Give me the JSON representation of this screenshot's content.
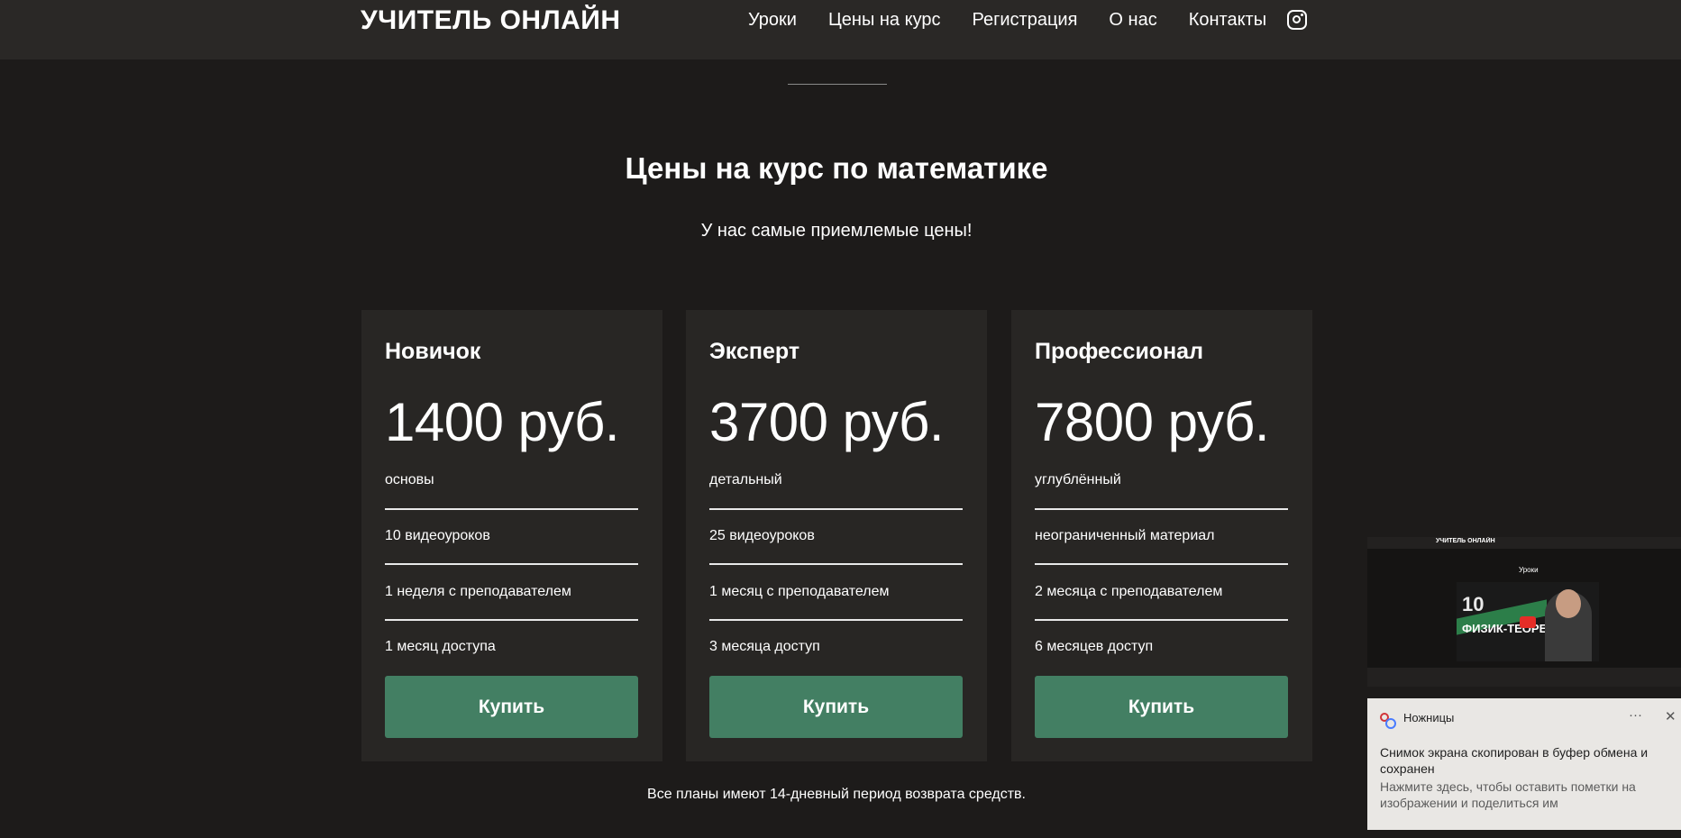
{
  "header": {
    "logo": "УЧИТЕЛЬ ОНЛАЙН",
    "nav": [
      "Уроки",
      "Цены на курс",
      "Регистрация",
      "О нас",
      "Контакты"
    ]
  },
  "section": {
    "title": "Цены на курс по математике",
    "subtitle": "У нас самые приемлемые цены!",
    "note": "Все планы имеют 14-дневный период возврата средств."
  },
  "plans": [
    {
      "name": "Новичок",
      "price": "1400 руб.",
      "features": [
        "основы",
        "10 видеоуроков",
        "1 неделя с преподавателем",
        "1 месяц доступа"
      ],
      "button": "Купить"
    },
    {
      "name": "Эксперт",
      "price": "3700 руб.",
      "features": [
        "детальный",
        "25 видеоуроков",
        "1 месяц с преподавателем",
        "3 месяца доступ"
      ],
      "button": "Купить"
    },
    {
      "name": "Профессионал",
      "price": "7800 руб.",
      "features": [
        "углублённый",
        "неограниченный материал",
        "2 месяца с преподавателем",
        "6 месяцев доступ"
      ],
      "button": "Купить"
    }
  ],
  "colors": {
    "accent_button": "#437f63",
    "background": "#1d1b1a",
    "card": "#282624"
  },
  "snip_preview": {
    "logo": "УЧИТЕЛЬ ОНЛАЙН",
    "title": "Уроки",
    "video_text": "ФИЗИК-ТЕОРЕТИК",
    "video_number": "10"
  },
  "toast": {
    "app": "Ножницы",
    "more": "···",
    "close": "✕",
    "message": "Снимок экрана скопирован в буфер обмена и сохранен",
    "hint": "Нажмите здесь, чтобы оставить пометки на изображении и поделиться им"
  }
}
